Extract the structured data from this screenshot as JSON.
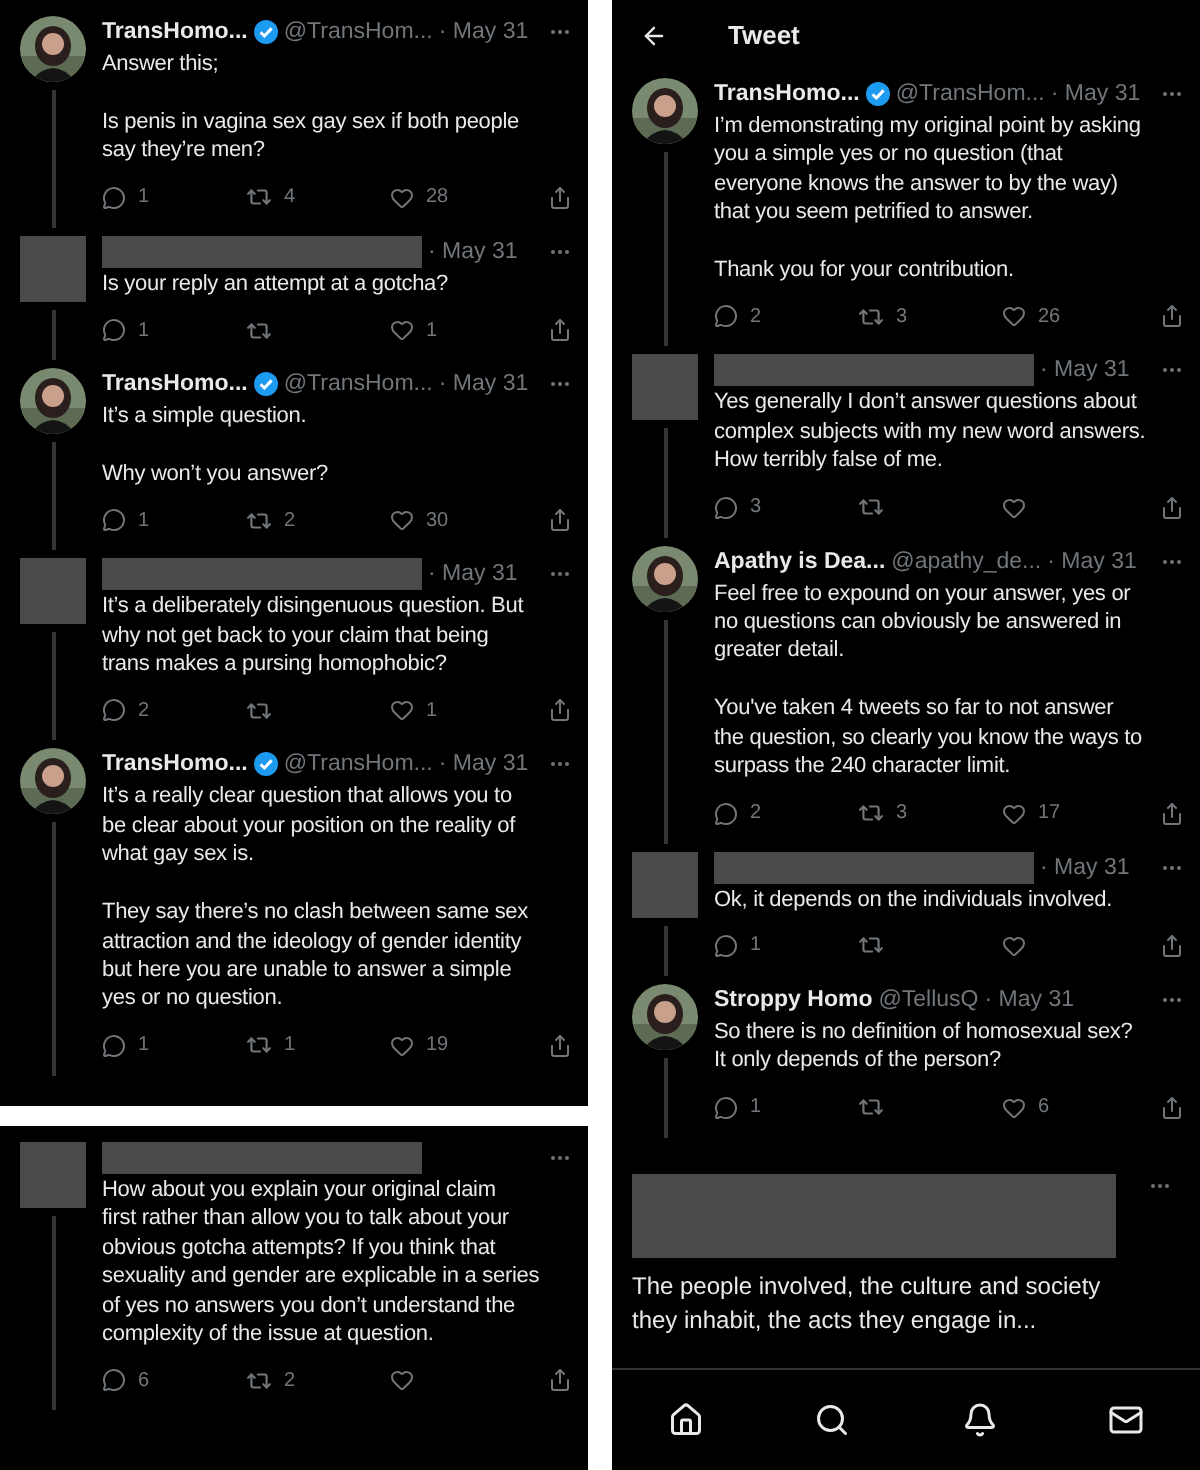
{
  "left_panel": {
    "tweets": [
      {
        "kind": "user",
        "name": "TransHomo...",
        "verified": true,
        "handle": "@TransHom...",
        "date": "· May 31",
        "text": "Answer this;\n\nIs penis in vagina sex gay sex if both people\nsay they’re men?",
        "replies": "1",
        "retweets": "4",
        "likes": "28"
      },
      {
        "kind": "redacted",
        "date": "· May 31",
        "text": "Is your reply an attempt at a gotcha?",
        "replies": "1",
        "likes": "1"
      },
      {
        "kind": "user",
        "name": "TransHomo...",
        "verified": true,
        "handle": "@TransHom...",
        "date": "· May 31",
        "text": "It’s a simple question.\n\nWhy won’t you answer?",
        "replies": "1",
        "retweets": "2",
        "likes": "30"
      },
      {
        "kind": "redacted",
        "date": "· May 31",
        "text": "It’s a deliberately disingenuous question. But\nwhy not get back to your claim that being\ntrans makes a pursing homophobic?",
        "replies": "2",
        "likes": "1"
      },
      {
        "kind": "user",
        "name": "TransHomo...",
        "verified": true,
        "handle": "@TransHom...",
        "date": "· May 31",
        "text": "It’s a really clear question that allows you to\nbe clear about your position on the reality of\nwhat gay sex is.\n\nThey say there’s no clash between same sex\nattraction and the ideology of gender identity\nbut here you are unable to answer a simple\nyes or no question.",
        "replies": "1",
        "retweets": "1",
        "likes": "19"
      }
    ]
  },
  "bottom_left_panel": {
    "tweets": [
      {
        "kind": "redacted",
        "text": "How about you explain your original claim\nfirst rather than allow you to talk about your\nobvious gotcha attempts? If you think that\nsexuality and gender are explicable in a series\nof yes no answers you don’t understand the\ncomplexity of the issue at question.",
        "replies": "6",
        "retweets": "2"
      }
    ]
  },
  "right_panel": {
    "header": {
      "title": "Tweet"
    },
    "tweets": [
      {
        "kind": "user",
        "name": "TransHomo...",
        "verified": true,
        "handle": "@TransHom...",
        "date": "· May 31",
        "text": "I’m demonstrating my original point by asking\nyou a simple yes or no question (that\neveryone knows the answer to by the way)\nthat you seem petrified to answer.\n\nThank you for your contribution.",
        "replies": "2",
        "retweets": "3",
        "likes": "26"
      },
      {
        "kind": "redacted",
        "date": "· May 31",
        "text": "Yes generally I don’t answer questions about\ncomplex subjects with my new word answers.\nHow terribly false of me.",
        "replies": "3"
      },
      {
        "kind": "user",
        "name": "Apathy is Dea...",
        "verified": false,
        "handle": "@apathy_de...",
        "date": "· May 31",
        "text": "Feel free to expound on your answer, yes or\nno questions can obviously be answered in\ngreater detail.\n\nYou've taken 4 tweets so far to not answer\nthe question, so clearly you know the ways to\nsurpass the 240 character limit.",
        "replies": "2",
        "retweets": "3",
        "likes": "17"
      },
      {
        "kind": "redacted",
        "date": "· May 31",
        "text": "Ok, it depends on the individuals involved.",
        "replies": "1"
      },
      {
        "kind": "user",
        "name": "Stroppy Homo",
        "verified": false,
        "handle": "@TellusQ",
        "date": "· May 31",
        "text": "So there is no definition of homosexual sex?\nIt only depends of the person?",
        "replies": "1",
        "likes": "6"
      }
    ],
    "focused_tweet": {
      "text": "The people involved, the culture and society\nthey inhabit, the acts they engage in..."
    }
  }
}
